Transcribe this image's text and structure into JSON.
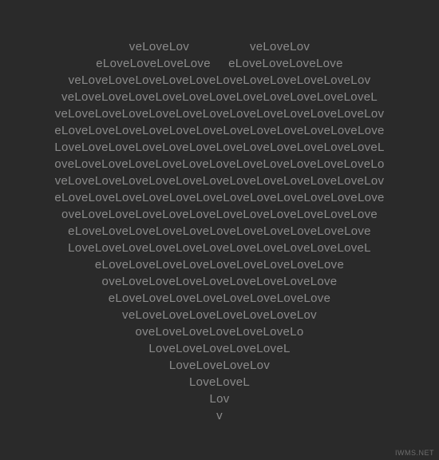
{
  "heart": {
    "lines": [
      "veLoveLov                 veLoveLov",
      "eLoveLoveLoveLove     eLoveLoveLoveLove",
      "veLoveLoveLoveLoveLoveLoveLoveLoveLoveLoveLov",
      "veLoveLoveLoveLoveLoveLoveLoveLoveLoveLoveLoveL",
      "veLoveLoveLoveLoveLoveLoveLoveLoveLoveLoveLoveLov",
      "eLoveLoveLoveLoveLoveLoveLoveLoveLoveLoveLoveLove",
      "LoveLoveLoveLoveLoveLoveLoveLoveLoveLoveLoveLoveL",
      "oveLoveLoveLoveLoveLoveLoveLoveLoveLoveLoveLoveLo",
      "veLoveLoveLoveLoveLoveLoveLoveLoveLoveLoveLoveLov",
      "eLoveLoveLoveLoveLoveLoveLoveLoveLoveLoveLoveLove",
      "oveLoveLoveLoveLoveLoveLoveLoveLoveLoveLoveLove",
      "eLoveLoveLoveLoveLoveLoveLoveLoveLoveLoveLove",
      "LoveLoveLoveLoveLoveLoveLoveLoveLoveLoveLoveL",
      "eLoveLoveLoveLoveLoveLoveLoveLoveLove",
      "oveLoveLoveLoveLoveLoveLoveLoveLove",
      "eLoveLoveLoveLoveLoveLoveLoveLove",
      "veLoveLoveLoveLoveLoveLoveLov",
      "oveLoveLoveLoveLoveLoveLo",
      "LoveLoveLoveLoveLoveL",
      "LoveLoveLoveLov",
      "LoveLoveL",
      "Lov",
      "v"
    ]
  },
  "watermark": "IWMS.NET"
}
